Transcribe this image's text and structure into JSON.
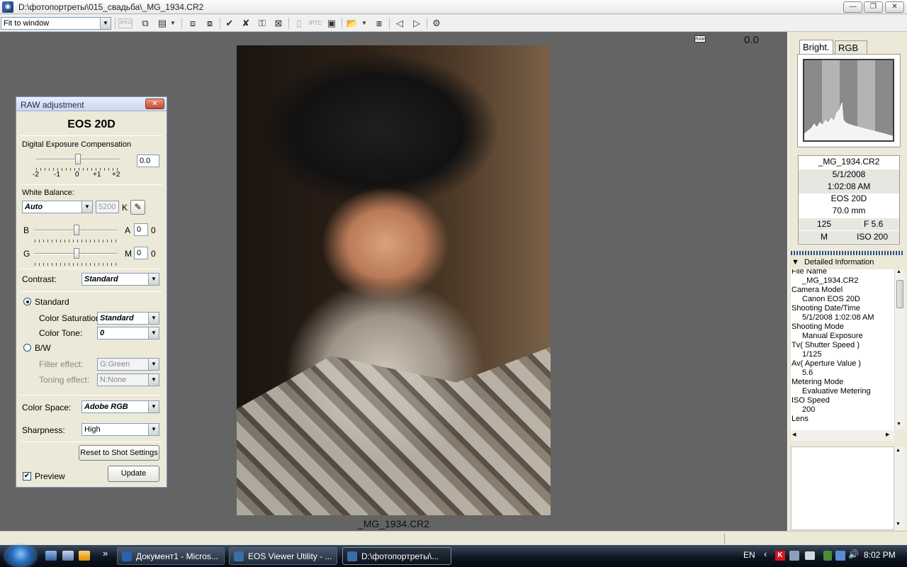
{
  "window": {
    "title": "D:\\фотопортреты\\015_свадьба\\_MG_1934.CR2",
    "minimize": "—",
    "restore": "❐",
    "close": "✕"
  },
  "toolbar": {
    "view_mode": "Fit to window",
    "jpeg_label": "JPEG",
    "iptc_label": "IPTC"
  },
  "viewer": {
    "filename": "_MG_1934.CR2",
    "raw_badge": "RAW",
    "zoom_value": "0.0"
  },
  "raw_panel": {
    "title": "RAW adjustment",
    "camera": "EOS 20D",
    "exposure": {
      "label": "Digital Exposure Compensation",
      "value": "0.0",
      "ticks": [
        "-2",
        "-1",
        "0",
        "+1",
        "+2"
      ]
    },
    "white_balance": {
      "label": "White Balance:",
      "mode": "Auto",
      "kelvin": "5200",
      "kelvin_unit": "K",
      "b_label": "B",
      "a_label": "A",
      "ba_value": "0",
      "ba_value2": "0",
      "g_label": "G",
      "m_label": "M",
      "gm_value": "0",
      "gm_value2": "0"
    },
    "contrast": {
      "label": "Contrast:",
      "value": "Standard"
    },
    "standard": {
      "label": "Standard",
      "saturation_label": "Color Saturation:",
      "saturation_value": "Standard",
      "tone_label": "Color Tone:",
      "tone_value": "0"
    },
    "bw": {
      "label": "B/W",
      "filter_label": "Filter effect:",
      "filter_value": "G:Green",
      "toning_label": "Toning effect:",
      "toning_value": "N:None"
    },
    "color_space": {
      "label": "Color Space:",
      "value": "Adobe RGB"
    },
    "sharpness": {
      "label": "Sharpness:",
      "value": "High"
    },
    "reset_button": "Reset to Shot Settings",
    "preview_label": "Preview",
    "update_button": "Update"
  },
  "right_panel": {
    "tabs": [
      "Bright.",
      "RGB"
    ],
    "info": {
      "file": "_MG_1934.CR2",
      "date": "5/1/2008",
      "time": "1:02:08 AM",
      "camera": "EOS 20D",
      "focal": "70.0 mm",
      "shutter": "125",
      "aperture": "F 5.6",
      "mode": "M",
      "iso": "ISO 200"
    },
    "details_header": "Detailed Information",
    "details": [
      {
        "k": "File Name",
        "v": "_MG_1934.CR2"
      },
      {
        "k": "Camera Model",
        "v": "Canon EOS 20D"
      },
      {
        "k": "Shooting Date/Time",
        "v": "5/1/2008 1:02:08 AM"
      },
      {
        "k": "Shooting Mode",
        "v": "Manual Exposure"
      },
      {
        "k": "Tv( Shutter Speed )",
        "v": "1/125"
      },
      {
        "k": "Av( Aperture Value )",
        "v": "5.6"
      },
      {
        "k": "Metering Mode",
        "v": "Evaluative Metering"
      },
      {
        "k": "ISO Speed",
        "v": "200"
      },
      {
        "k": "Lens",
        "v": ""
      }
    ]
  },
  "taskbar": {
    "tasks": [
      {
        "label": "Документ1 - Micros..."
      },
      {
        "label": "EOS Viewer Utility - ..."
      },
      {
        "label": "D:\\фотопортреты\\..."
      }
    ],
    "more": "»",
    "lang": "EN",
    "clock": "8:02 PM"
  }
}
